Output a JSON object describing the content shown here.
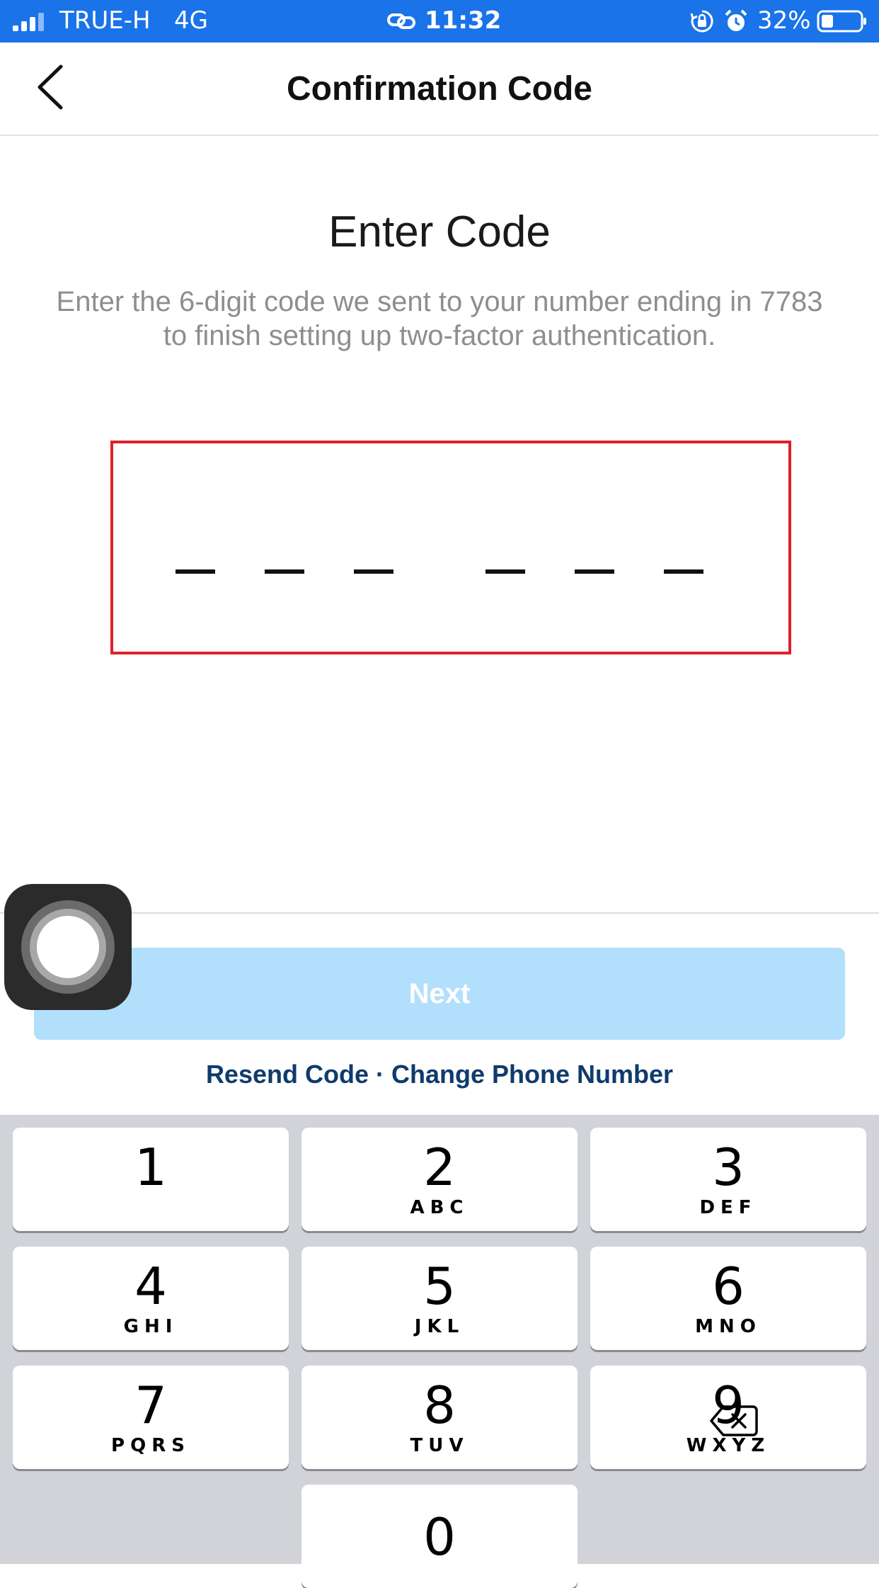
{
  "status_bar": {
    "carrier": "TRUE-H",
    "network": "4G",
    "time": "11:32",
    "battery_percent": "32%",
    "icons": [
      "signal-icon",
      "link-icon",
      "orientation-lock-icon",
      "alarm-icon",
      "battery-icon"
    ]
  },
  "header": {
    "title": "Confirmation Code",
    "back_icon": "chevron-left-icon"
  },
  "main": {
    "heading": "Enter Code",
    "subtitle": "Enter the 6-digit code we sent to your number ending in 7783 to finish setting up two-factor authentication.",
    "code_slots": 6,
    "code_value": ""
  },
  "actions": {
    "next_label": "Next",
    "resend_label": "Resend Code",
    "separator": "·",
    "change_phone_label": "Change Phone Number"
  },
  "keypad": {
    "keys": [
      {
        "num": "1",
        "letters": ""
      },
      {
        "num": "2",
        "letters": "ABC"
      },
      {
        "num": "3",
        "letters": "DEF"
      },
      {
        "num": "4",
        "letters": "GHI"
      },
      {
        "num": "5",
        "letters": "JKL"
      },
      {
        "num": "6",
        "letters": "MNO"
      },
      {
        "num": "7",
        "letters": "PQRS"
      },
      {
        "num": "8",
        "letters": "TUV"
      },
      {
        "num": "9",
        "letters": "WXYZ"
      },
      {
        "num": "0",
        "letters": ""
      }
    ],
    "delete_icon": "backspace-icon"
  },
  "colors": {
    "status_bar_bg": "#1a73e8",
    "code_box_border": "#e0202a",
    "next_button_bg": "#b2dffc",
    "link_text": "#0f3b6d",
    "keypad_bg": "#d1d3d9"
  }
}
